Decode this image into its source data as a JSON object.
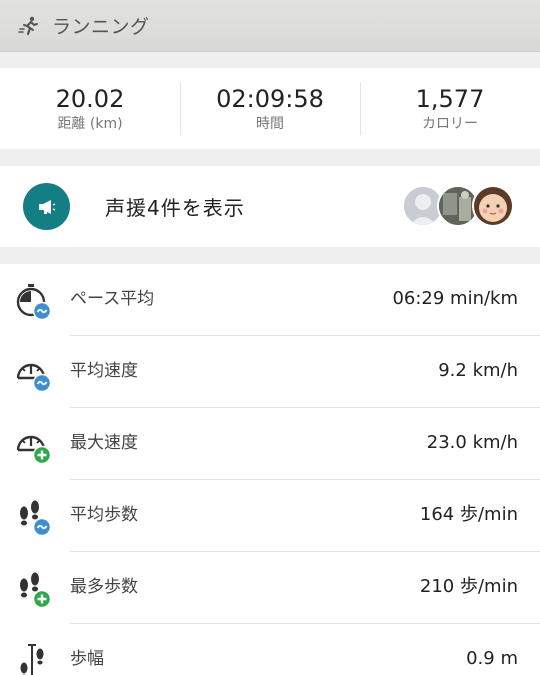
{
  "header": {
    "title": "ランニング",
    "icon": "running-icon"
  },
  "summary": [
    {
      "value": "20.02",
      "label": "距離 (km)"
    },
    {
      "value": "02:09:58",
      "label": "時間"
    },
    {
      "value": "1,577",
      "label": "カロリー"
    }
  ],
  "cheer": {
    "label": "声援4件を表示",
    "icon": "megaphone-icon",
    "accent": "#147e85"
  },
  "metrics": [
    {
      "label": "ペース平均",
      "value": "06:29 min/km",
      "icon": "stopwatch-icon",
      "badge": "average"
    },
    {
      "label": "平均速度",
      "value": "9.2 km/h",
      "icon": "speedometer-icon",
      "badge": "average"
    },
    {
      "label": "最大速度",
      "value": "23.0 km/h",
      "icon": "speedometer-icon",
      "badge": "max"
    },
    {
      "label": "平均歩数",
      "value": "164 歩/min",
      "icon": "footprints-icon",
      "badge": "average"
    },
    {
      "label": "最多歩数",
      "value": "210 歩/min",
      "icon": "footprints-icon",
      "badge": "max"
    },
    {
      "label": "歩幅",
      "value": "0.9 m",
      "icon": "stride-icon"
    }
  ],
  "colors": {
    "average_badge": "#3d8fd1",
    "max_badge": "#2ea84a"
  }
}
